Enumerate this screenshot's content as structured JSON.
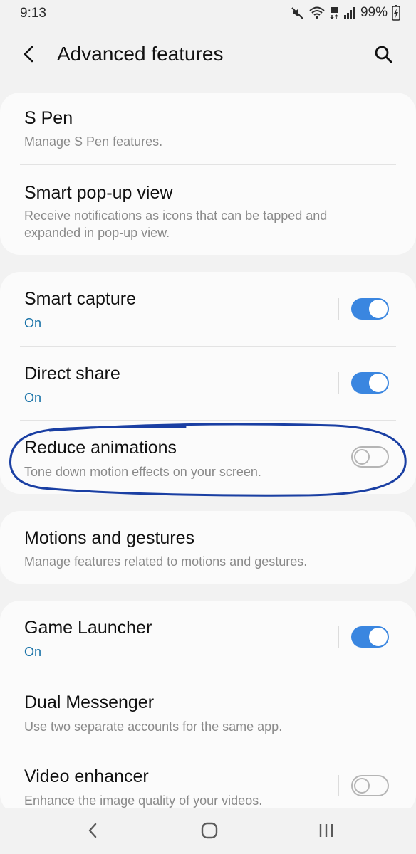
{
  "status_bar": {
    "time": "9:13",
    "battery_percent": "99%"
  },
  "app_bar": {
    "title": "Advanced features"
  },
  "sections": [
    {
      "items": [
        {
          "title": "S Pen",
          "subtitle": "Manage S Pen features."
        },
        {
          "title": "Smart pop-up view",
          "subtitle_line1": "Receive notifications as icons that can be tapped and",
          "subtitle_line2": "expanded in pop-up view."
        }
      ]
    },
    {
      "items": [
        {
          "title": "Smart capture",
          "subtitle": "On",
          "toggle": true
        },
        {
          "title": "Direct share",
          "subtitle": "On",
          "toggle": true
        },
        {
          "title": "Reduce animations",
          "subtitle": "Tone down motion effects on your screen.",
          "toggle": false
        }
      ]
    },
    {
      "items": [
        {
          "title": "Motions and gestures",
          "subtitle": "Manage features related to motions and gestures."
        }
      ]
    },
    {
      "items": [
        {
          "title": "Game Launcher",
          "subtitle": "On",
          "toggle": true
        },
        {
          "title": "Dual Messenger",
          "subtitle": "Use two separate accounts for the same app."
        },
        {
          "title": "Video enhancer",
          "subtitle": "Enhance the image quality of your videos.",
          "toggle": false
        }
      ]
    }
  ],
  "colors": {
    "accent": "#3a86e0",
    "on_text": "#1a73a8",
    "annotation": "#1a3fa3"
  }
}
